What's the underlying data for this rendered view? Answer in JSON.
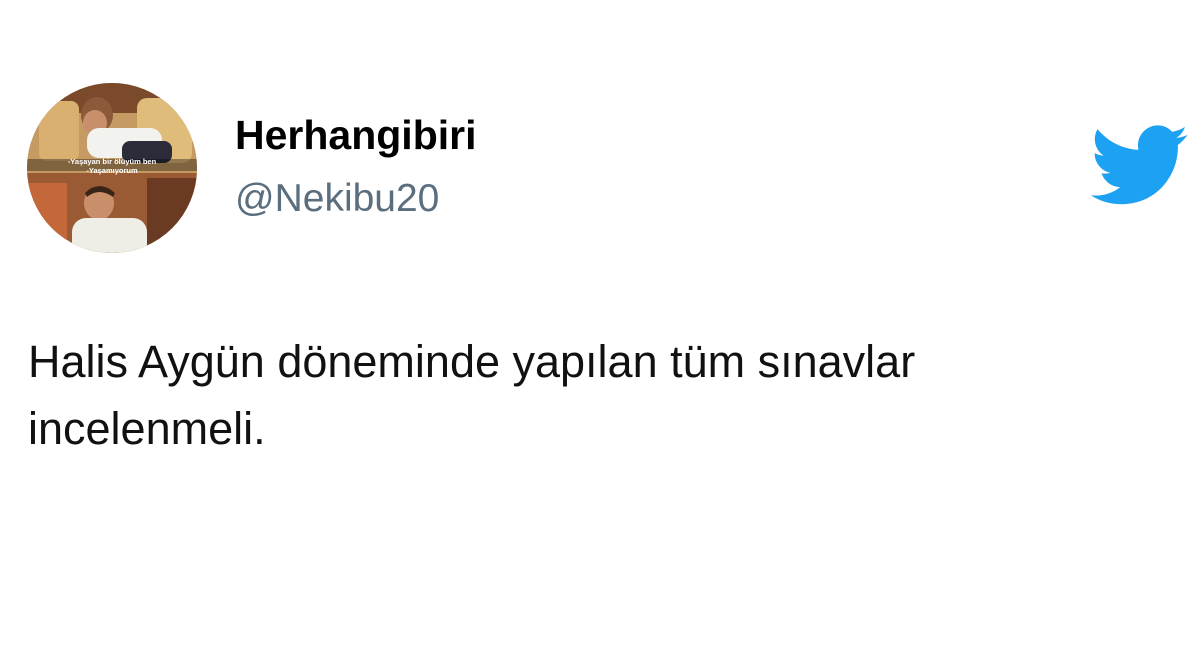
{
  "user": {
    "display_name": "Herhangibiri",
    "handle": "@Nekibu20",
    "avatar": {
      "caption_line1": "-Yaşayan bir ölüyüm ben",
      "caption_line2": "-Yaşamıyorum"
    }
  },
  "tweet": {
    "text_lines": [
      "Halis Aygün döneminde yapılan tüm sınavlar",
      "incelenmeli."
    ]
  },
  "brand": {
    "icon": "twitter-bird-icon",
    "color": "#1da1f2"
  }
}
